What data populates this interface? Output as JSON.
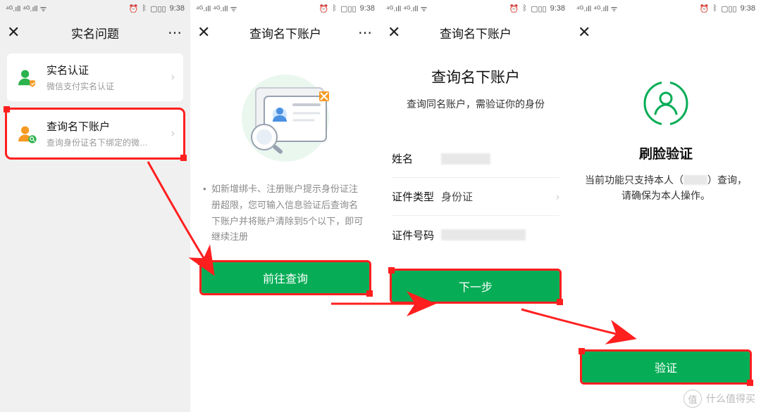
{
  "status": {
    "signal": "⁴ᴳ.ıll ⁴ᴳ.ıll ᯤ",
    "alarm": "⏰",
    "bt": "ᛒ",
    "bat": "▢▯▯",
    "time": "9:38"
  },
  "panel1": {
    "nav_title": "实名问题",
    "card1": {
      "title": "实名认证",
      "sub": "微信支付实名认证"
    },
    "card2": {
      "title": "查询名下账户",
      "sub": "查询身份证名下绑定的微…"
    }
  },
  "panel2": {
    "nav_title": "查询名下账户",
    "note": "如新增绑卡、注册账户提示身份证注册超限，您可输入信息验证后查询名下账户并将账户清除到5个以下，即可继续注册",
    "btn": "前往查询"
  },
  "panel3": {
    "nav_title": "查询名下账户",
    "title": "查询名下账户",
    "sub": "查询同名账户，需验证你的身份",
    "form": {
      "name_label": "姓名",
      "type_label": "证件类型",
      "type_value": "身份证",
      "id_label": "证件号码"
    },
    "btn": "下一步"
  },
  "panel4": {
    "title": "刷脸验证",
    "desc_pre": "当前功能只支持本人（",
    "desc_post": "）查询，请确保为本人操作。",
    "btn": "验证"
  },
  "watermark": {
    "badge": "值",
    "text": "什么值得买"
  }
}
